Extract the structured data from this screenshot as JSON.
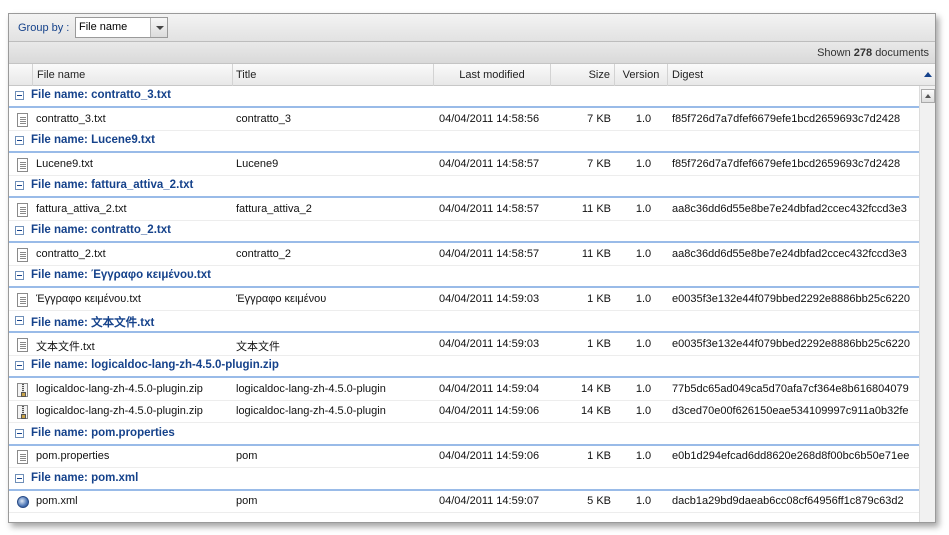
{
  "toolbar": {
    "group_by_label": "Group by :",
    "group_by_value": "File name"
  },
  "status": {
    "prefix": "Shown",
    "count": "278",
    "suffix": "documents"
  },
  "columns": {
    "file_name": "File name",
    "title": "Title",
    "last_modified": "Last modified",
    "size": "Size",
    "version": "Version",
    "digest": "Digest"
  },
  "groups": [
    {
      "label": "File name: contratto_3.txt",
      "rows": [
        {
          "icon": "text-file-icon",
          "name": "contratto_3.txt",
          "title": "contratto_3",
          "modified": "04/04/2011 14:58:56",
          "size": "7 KB",
          "version": "1.0",
          "digest": "f85f726d7a7dfef6679efe1bcd2659693c7d2428"
        }
      ]
    },
    {
      "label": "File name: Lucene9.txt",
      "rows": [
        {
          "icon": "text-file-icon",
          "name": "Lucene9.txt",
          "title": "Lucene9",
          "modified": "04/04/2011 14:58:57",
          "size": "7 KB",
          "version": "1.0",
          "digest": "f85f726d7a7dfef6679efe1bcd2659693c7d2428"
        }
      ]
    },
    {
      "label": "File name: fattura_attiva_2.txt",
      "rows": [
        {
          "icon": "text-file-icon",
          "name": "fattura_attiva_2.txt",
          "title": "fattura_attiva_2",
          "modified": "04/04/2011 14:58:57",
          "size": "11 KB",
          "version": "1.0",
          "digest": "aa8c36dd6d55e8be7e24dbfad2ccec432fccd3e3"
        }
      ]
    },
    {
      "label": "File name: contratto_2.txt",
      "rows": [
        {
          "icon": "text-file-icon",
          "name": "contratto_2.txt",
          "title": "contratto_2",
          "modified": "04/04/2011 14:58:57",
          "size": "11 KB",
          "version": "1.0",
          "digest": "aa8c36dd6d55e8be7e24dbfad2ccec432fccd3e3"
        }
      ]
    },
    {
      "label": "File name: Έγγραφο κειμένου.txt",
      "rows": [
        {
          "icon": "text-file-icon",
          "name": "Έγγραφο κειμένου.txt",
          "title": "Έγγραφο κειμένου",
          "modified": "04/04/2011 14:59:03",
          "size": "1 KB",
          "version": "1.0",
          "digest": "e0035f3e132e44f079bbed2292e8886bb25c6220"
        }
      ]
    },
    {
      "label": "File name: 文本文件.txt",
      "rows": [
        {
          "icon": "text-file-icon",
          "name": "文本文件.txt",
          "title": "文本文件",
          "modified": "04/04/2011 14:59:03",
          "size": "1 KB",
          "version": "1.0",
          "digest": "e0035f3e132e44f079bbed2292e8886bb25c6220"
        }
      ]
    },
    {
      "label": "File name: logicaldoc-lang-zh-4.5.0-plugin.zip",
      "rows": [
        {
          "icon": "zip-file-icon",
          "name": "logicaldoc-lang-zh-4.5.0-plugin.zip",
          "title": "logicaldoc-lang-zh-4.5.0-plugin",
          "modified": "04/04/2011 14:59:04",
          "size": "14 KB",
          "version": "1.0",
          "digest": "77b5dc65ad049ca5d70afa7cf364e8b616804079"
        },
        {
          "icon": "zip-file-icon",
          "name": "logicaldoc-lang-zh-4.5.0-plugin.zip",
          "title": "logicaldoc-lang-zh-4.5.0-plugin",
          "modified": "04/04/2011 14:59:06",
          "size": "14 KB",
          "version": "1.0",
          "digest": "d3ced70e00f626150eae534109997c911a0b32fe"
        }
      ]
    },
    {
      "label": "File name: pom.properties",
      "rows": [
        {
          "icon": "text-file-icon",
          "name": "pom.properties",
          "title": "pom",
          "modified": "04/04/2011 14:59:06",
          "size": "1 KB",
          "version": "1.0",
          "digest": "e0b1d294efcad6dd8620e268d8f00bc6b50e71ee"
        }
      ]
    },
    {
      "label": "File name: pom.xml",
      "rows": [
        {
          "icon": "xml-file-icon",
          "name": "pom.xml",
          "title": "pom",
          "modified": "04/04/2011 14:59:07",
          "size": "5 KB",
          "version": "1.0",
          "digest": "dacb1a29bd9daeab6cc08cf64956ff1c879c63d2"
        }
      ]
    }
  ]
}
